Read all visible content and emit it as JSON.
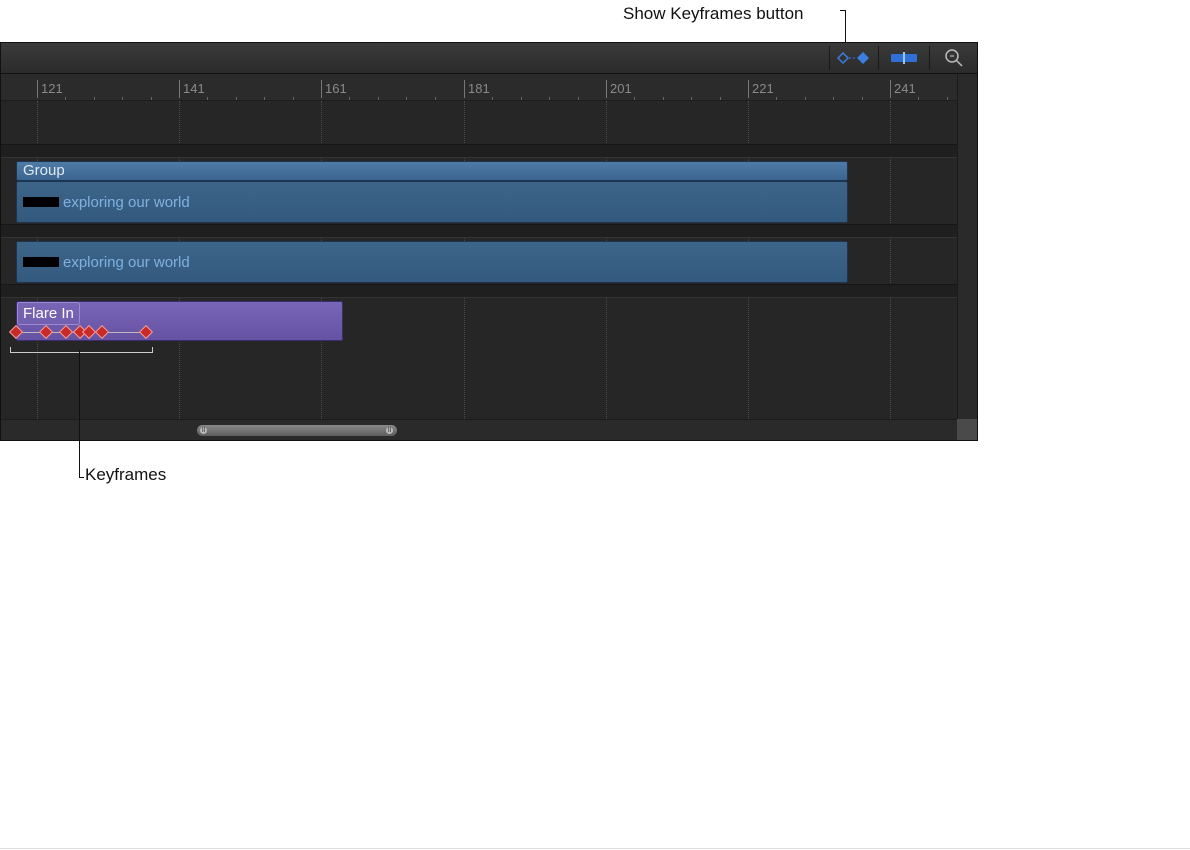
{
  "callouts": {
    "show_keyframes": "Show Keyframes button",
    "keyframes": "Keyframes"
  },
  "toolbar": {
    "buttons": [
      {
        "name": "show-keyframes-button",
        "icon": "keyframe-diamonds-icon",
        "active": true
      },
      {
        "name": "snap-button",
        "icon": "snap-icon",
        "active": true
      },
      {
        "name": "zoom-button",
        "icon": "zoom-icon",
        "active": false
      }
    ]
  },
  "ruler": {
    "ticks": [
      "121",
      "141",
      "161",
      "181",
      "201",
      "221",
      "241"
    ]
  },
  "tracks": {
    "group": {
      "label": "Group",
      "layer_label": "exploring our world"
    },
    "layer2": {
      "label": "exploring our world"
    },
    "behavior": {
      "label": "Flare In",
      "keyframe_count": 7
    }
  },
  "colors": {
    "group_bar": "#3d6589",
    "behavior_bar": "#6552a3",
    "keyframe": "#c82a2a",
    "accent_blue": "#3a7fe0"
  }
}
